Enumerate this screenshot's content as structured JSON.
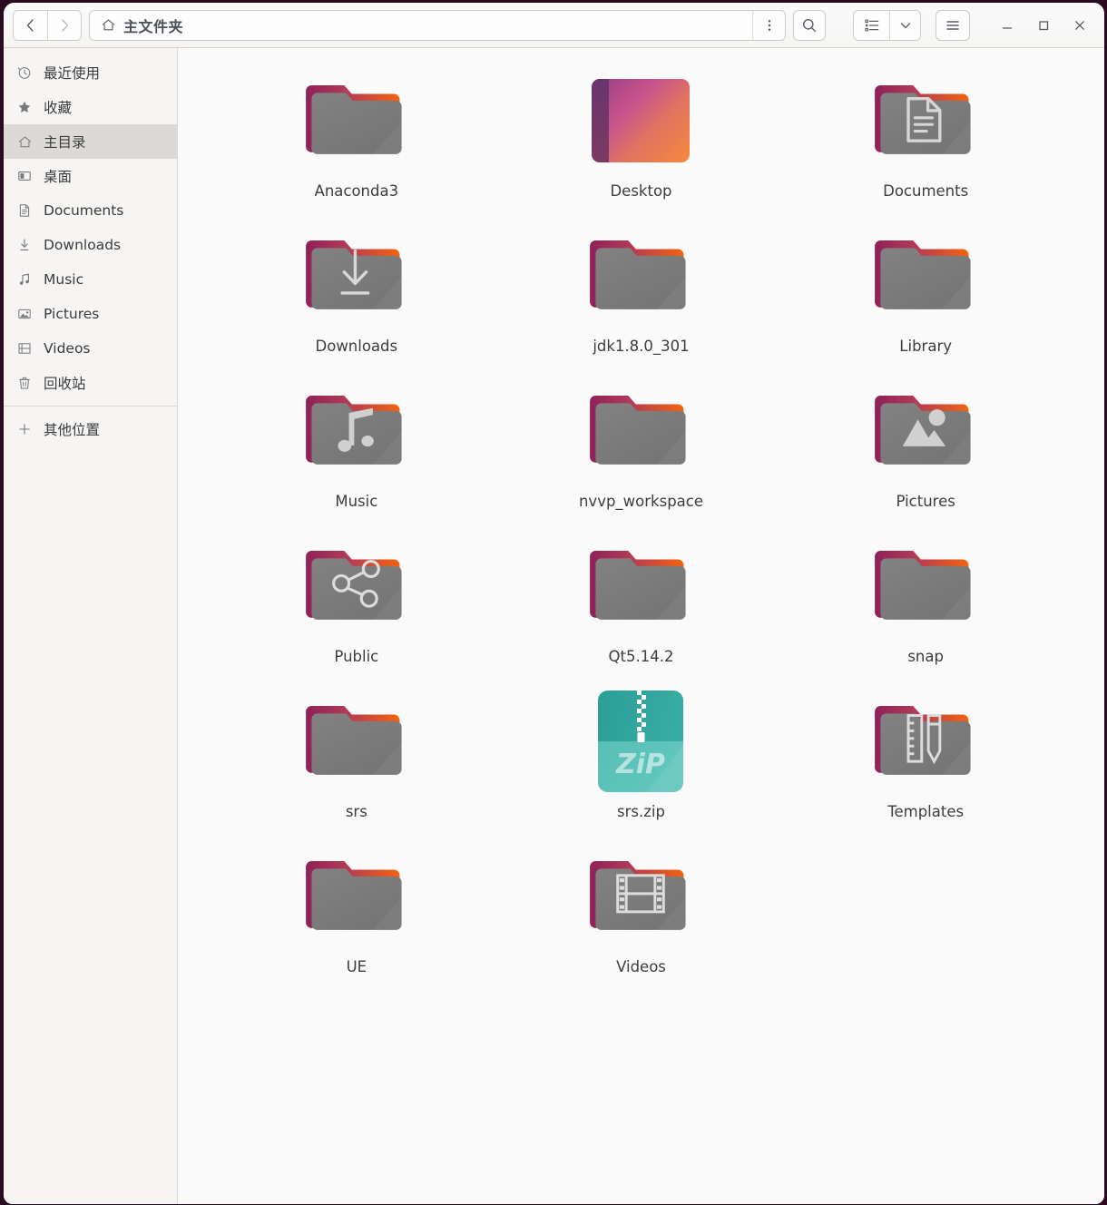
{
  "window": {
    "title": "主文件夹",
    "bg_outside": "#2c0b20",
    "bg": "#fafafa"
  },
  "header": {
    "back_label": "‹",
    "forward_label": "›",
    "path_label": "主文件夹",
    "path_icon": "home-icon",
    "path_menu_icon": "vertical-dots-icon",
    "search_icon": "search-icon",
    "view_list_icon": "list-view-icon",
    "view_chevron_icon": "chevron-down-icon",
    "menu_icon": "hamburger-menu-icon",
    "minimize_icon": "minimize-icon",
    "maximize_icon": "maximize-icon",
    "close_icon": "close-icon"
  },
  "sidebar": {
    "selected_index": 2,
    "items": [
      {
        "label": "最近使用",
        "icon": "clock-icon"
      },
      {
        "label": "收藏",
        "icon": "star-icon"
      },
      {
        "label": "主目录",
        "icon": "home-icon"
      },
      {
        "label": "桌面",
        "icon": "desktop-icon"
      },
      {
        "label": "Documents",
        "icon": "document-icon"
      },
      {
        "label": "Downloads",
        "icon": "download-icon"
      },
      {
        "label": "Music",
        "icon": "music-note-icon"
      },
      {
        "label": "Pictures",
        "icon": "image-icon"
      },
      {
        "label": "Videos",
        "icon": "film-icon"
      },
      {
        "label": "回收站",
        "icon": "trash-icon"
      }
    ],
    "other_locations": {
      "label": "其他位置",
      "icon": "plus-icon"
    }
  },
  "files": [
    {
      "name": "Anaconda3",
      "type": "folder",
      "glyph": "none"
    },
    {
      "name": "Desktop",
      "type": "desktop",
      "glyph": "none"
    },
    {
      "name": "Documents",
      "type": "folder",
      "glyph": "document"
    },
    {
      "name": "Downloads",
      "type": "folder",
      "glyph": "download"
    },
    {
      "name": "jdk1.8.0_301",
      "type": "folder",
      "glyph": "none"
    },
    {
      "name": "Library",
      "type": "folder",
      "glyph": "none"
    },
    {
      "name": "Music",
      "type": "folder",
      "glyph": "music"
    },
    {
      "name": "nvvp_workspace",
      "type": "folder",
      "glyph": "none"
    },
    {
      "name": "Pictures",
      "type": "folder",
      "glyph": "image"
    },
    {
      "name": "Public",
      "type": "folder",
      "glyph": "share"
    },
    {
      "name": "Qt5.14.2",
      "type": "folder",
      "glyph": "none"
    },
    {
      "name": "snap",
      "type": "folder",
      "glyph": "none"
    },
    {
      "name": "srs",
      "type": "folder",
      "glyph": "none"
    },
    {
      "name": "srs.zip",
      "type": "zip",
      "glyph": "zip",
      "zip_text": "ZiP"
    },
    {
      "name": "Templates",
      "type": "folder",
      "glyph": "templates"
    },
    {
      "name": "UE",
      "type": "folder",
      "glyph": "none"
    },
    {
      "name": "Videos",
      "type": "folder",
      "glyph": "film"
    }
  ],
  "colors": {
    "folder_body": "#7f7f7f",
    "folder_tab_start": "#96265e",
    "folder_tab_end": "#f1601c",
    "zip_dark": "#2fa39c",
    "zip_light": "#5dc0b8",
    "sidebar_selected": "#dcdad7"
  }
}
